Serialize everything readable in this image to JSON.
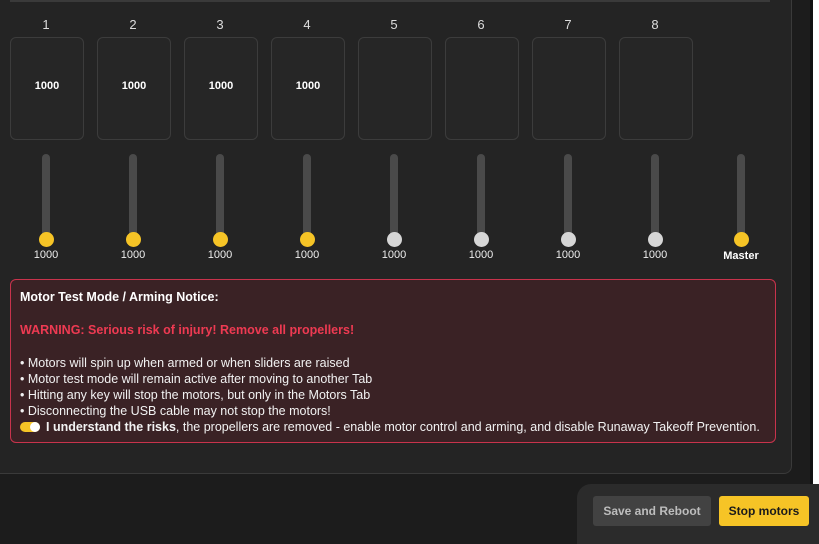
{
  "motors": [
    {
      "number": "1",
      "box_value": "1000",
      "slider_value": "1000",
      "active": true
    },
    {
      "number": "2",
      "box_value": "1000",
      "slider_value": "1000",
      "active": true
    },
    {
      "number": "3",
      "box_value": "1000",
      "slider_value": "1000",
      "active": true
    },
    {
      "number": "4",
      "box_value": "1000",
      "slider_value": "1000",
      "active": true
    },
    {
      "number": "5",
      "box_value": "",
      "slider_value": "1000",
      "active": false
    },
    {
      "number": "6",
      "box_value": "",
      "slider_value": "1000",
      "active": false
    },
    {
      "number": "7",
      "box_value": "",
      "slider_value": "1000",
      "active": false
    },
    {
      "number": "8",
      "box_value": "",
      "slider_value": "1000",
      "active": false
    }
  ],
  "master": {
    "label": "Master"
  },
  "notice": {
    "title": "Motor Test Mode / Arming Notice:",
    "warning": "WARNING: Serious risk of injury! Remove all propellers!",
    "bullets": [
      "• Motors will spin up when armed or when sliders are raised",
      "• Motor test mode will remain active after moving to another Tab",
      "• Hitting any key will stop the motors, but only in the Motors Tab",
      "• Disconnecting the USB cable may not stop the motors!"
    ],
    "ack_bold": "I understand the risks",
    "ack_rest": ", the propellers are removed - enable motor control and arming, and disable Runaway Takeoff Prevention.",
    "ack_checked": true
  },
  "buttons": {
    "save_reboot": "Save and Reboot",
    "stop_motors": "Stop motors"
  },
  "colors": {
    "accent": "#f6c426",
    "warning": "#ee3a52",
    "notice_bg": "#3a2225",
    "notice_border": "#c8334c"
  }
}
